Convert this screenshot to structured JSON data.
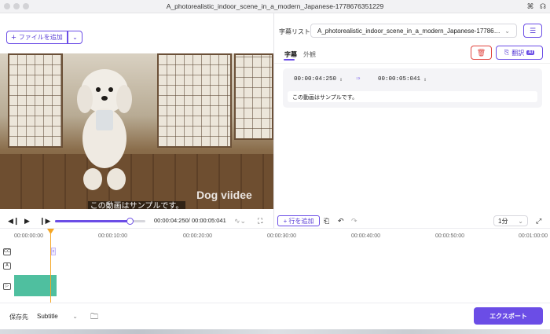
{
  "window": {
    "title": "A_photorealistic_indoor_scene_in_a_modern_Japanese-1778676351229"
  },
  "toolbar": {
    "add_file_label": "ファイルを追加"
  },
  "video": {
    "watermark": "Dog viidee",
    "caption": "この動画はサンプルです。"
  },
  "player": {
    "time_readout": "00:00:04:250/ 00:00:05:041",
    "progress_fraction": 0.83
  },
  "right_panel": {
    "subtitle_list_label": "字幕リスト",
    "subtitle_file": "A_photorealistic_indoor_scene_in_a_modern_Japanese-177867...",
    "tabs": [
      {
        "label": "字幕",
        "active": true
      },
      {
        "label": "外観",
        "active": false
      }
    ],
    "translate_label": "翻訳",
    "ai_badge": "AI",
    "entries": [
      {
        "start": "00:00:04:250",
        "end": "00:00:05:041",
        "text": "この動画はサンプルです。"
      }
    ]
  },
  "timeline": {
    "add_row_label": "行を追加",
    "zoom_value": "1分",
    "ticks": [
      "00:00:00:00",
      "00:00:10:00",
      "00:00:20:00",
      "00:00:30:00",
      "00:00:40:00",
      "00:00:50:00",
      "00:01:00:00"
    ],
    "track_icons": [
      "CC",
      "A",
      "▷"
    ]
  },
  "footer": {
    "save_to_label": "保存先",
    "save_to_value": "Subtitle",
    "export_label": "エクスポート"
  },
  "colors": {
    "accent": "#6b4de6",
    "playhead": "#f5a623",
    "clip": "#4fbf9f",
    "delete": "#e0443e"
  }
}
